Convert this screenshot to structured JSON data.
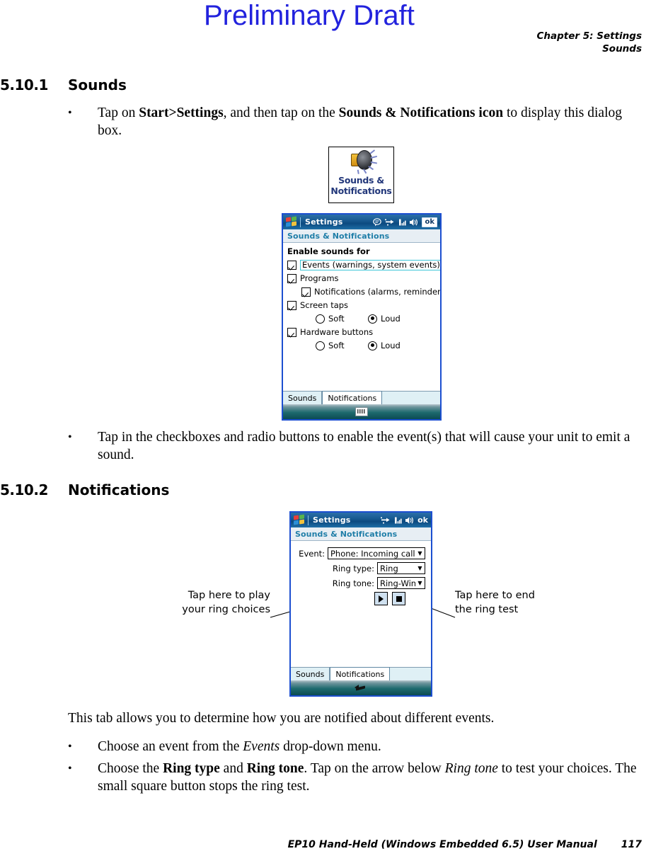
{
  "watermark": "Preliminary Draft",
  "running_header": {
    "chapter": "Chapter 5:  Settings",
    "section": "Sounds"
  },
  "sections": [
    {
      "number": "5.10.1",
      "title": "Sounds"
    },
    {
      "number": "5.10.2",
      "title": "Notifications"
    }
  ],
  "body": {
    "bullet1_pre": "Tap on ",
    "bullet1_b1": "Start>Settings",
    "bullet1_mid": ", and then tap on the ",
    "bullet1_b2": "Sounds & Notifications icon",
    "bullet1_post": " to display this dialog box.",
    "bullet2": "Tap in the checkboxes and radio buttons to enable the event(s) that will cause your unit to emit a sound.",
    "para1": "This tab allows you to determine how you are notified about different events.",
    "bullet3_pre": "Choose an event from the ",
    "bullet3_i1": "Events",
    "bullet3_post": " drop-down menu.",
    "bullet4_pre": "Choose the ",
    "bullet4_b1": "Ring type",
    "bullet4_mid1": " and ",
    "bullet4_b2": "Ring tone",
    "bullet4_mid2": ". Tap on the arrow below ",
    "bullet4_i1": "Ring tone",
    "bullet4_post": " to test your choices. The small square button stops the ring test."
  },
  "icon_tile": {
    "label_line1": "Sounds &",
    "label_line2": "Notifications",
    "icon": "speaker-icon"
  },
  "device_sounds": {
    "titlebar": {
      "logo": "windows-flag-icon",
      "title": "Settings",
      "tray": [
        {
          "name": "messaging-icon",
          "glyph": "✉"
        },
        {
          "name": "connectivity-icon",
          "glyph": "⇄"
        },
        {
          "name": "signal-strength-icon",
          "glyph": "█"
        },
        {
          "name": "volume-icon",
          "glyph": "◀"
        }
      ],
      "ok_label": "ok"
    },
    "subtitle": "Sounds & Notifications",
    "group_label": "Enable sounds for",
    "options": [
      {
        "name": "events",
        "label": "Events (warnings, system events)",
        "checked": true,
        "indent": 0,
        "focused": true
      },
      {
        "name": "programs",
        "label": "Programs",
        "checked": true,
        "indent": 0,
        "focused": false
      },
      {
        "name": "notifications",
        "label": "Notifications (alarms, reminders)",
        "checked": true,
        "indent": 1,
        "focused": false
      },
      {
        "name": "screen-taps",
        "label": "Screen taps",
        "checked": true,
        "indent": 0,
        "focused": false
      },
      {
        "name": "hardware-buttons",
        "label": "Hardware buttons",
        "checked": true,
        "indent": 0,
        "focused": false
      }
    ],
    "radio_soft": "Soft",
    "radio_loud": "Loud",
    "screen_taps_volume": "Loud",
    "hardware_buttons_volume": "Loud",
    "tabs": [
      {
        "label": "Sounds",
        "selected": false
      },
      {
        "label": "Notifications",
        "selected": true
      }
    ],
    "taskbar_icon": "keyboard-icon"
  },
  "device_notifications": {
    "titlebar": {
      "logo": "windows-flag-icon",
      "title": "Settings",
      "tray": [
        {
          "name": "connectivity-icon",
          "glyph": "⇄"
        },
        {
          "name": "signal-strength-icon",
          "glyph": "█"
        },
        {
          "name": "volume-icon",
          "glyph": "◀"
        }
      ],
      "ok_label": "ok"
    },
    "subtitle": "Sounds & Notifications",
    "fields": [
      {
        "name": "event",
        "label": "Event:",
        "value": "Phone: Incoming call"
      },
      {
        "name": "ring-type",
        "label": "Ring type:",
        "value": "Ring"
      },
      {
        "name": "ring-tone",
        "label": "Ring tone:",
        "value": "Ring-WindowsMob"
      }
    ],
    "buttons": [
      {
        "name": "play-button",
        "glyph": "play"
      },
      {
        "name": "stop-button",
        "glyph": "stop"
      }
    ],
    "tabs": [
      {
        "label": "Sounds",
        "selected": false
      },
      {
        "label": "Notifications",
        "selected": true
      }
    ],
    "taskbar_icon": "arrow-icon"
  },
  "callouts": {
    "left_line1": "Tap here to play",
    "left_line2": "your ring choices",
    "right_line1": "Tap here to end",
    "right_line2": "the ring test"
  },
  "footer": {
    "manual": "EP10 Hand-Held (Windows Embedded 6.5) User Manual",
    "page": "117"
  },
  "colors": {
    "watermark": "#2222dd",
    "device_border": "#1c4fd0",
    "subtitle_text": "#1f7ea8",
    "icon_label": "#22377a"
  }
}
